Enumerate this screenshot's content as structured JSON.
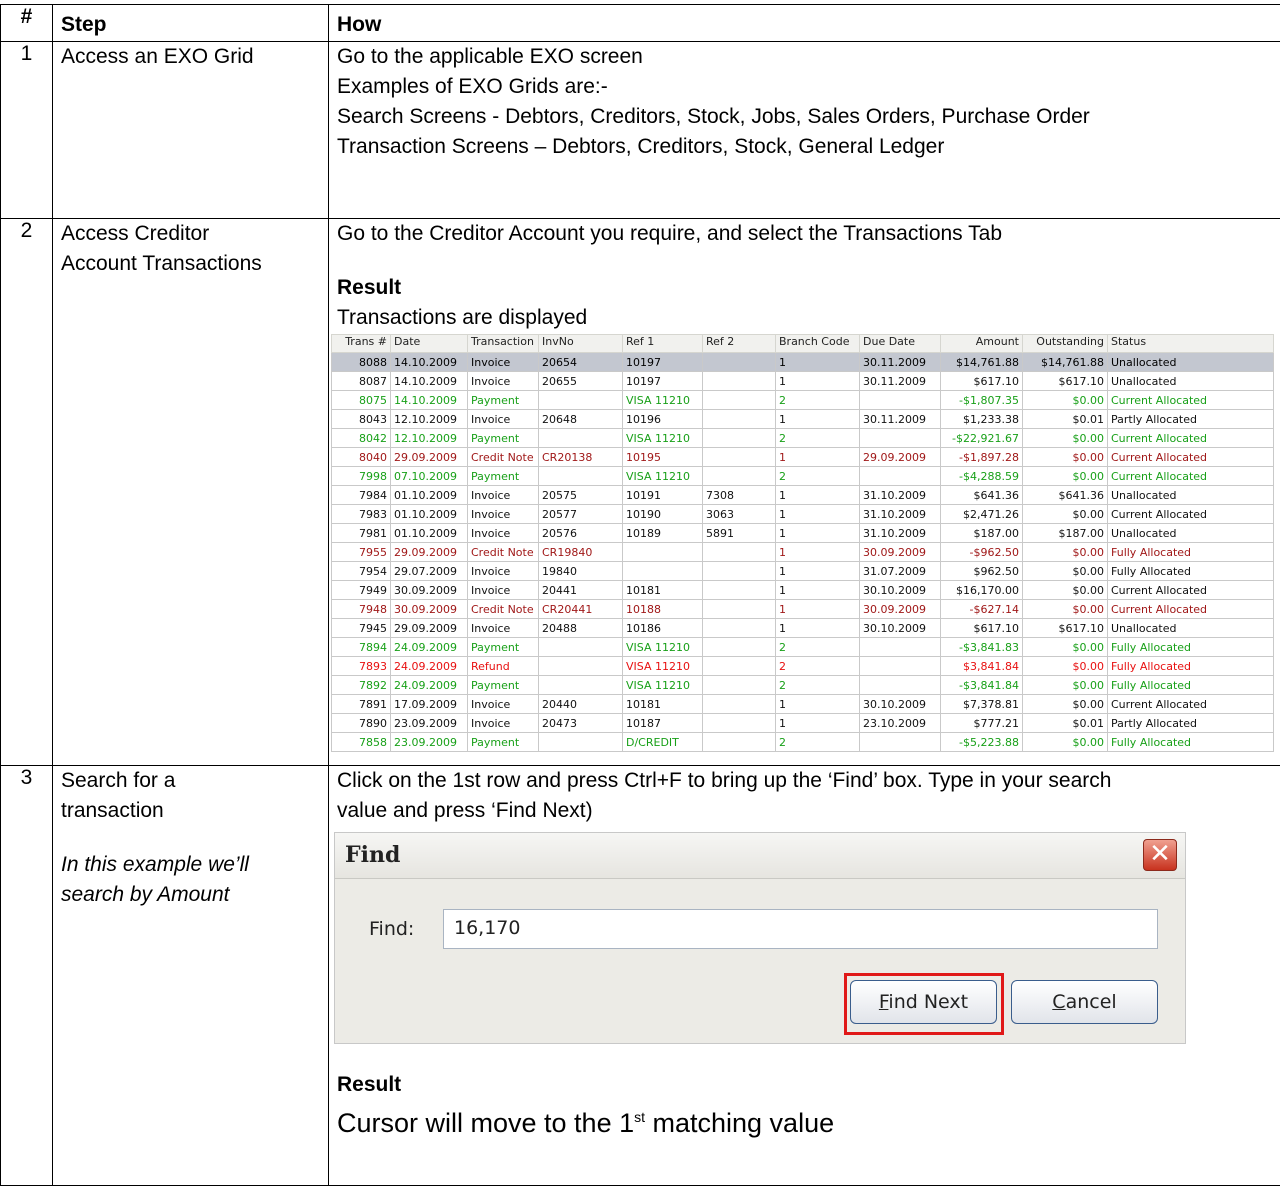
{
  "header": {
    "num": "#",
    "step": "Step",
    "how": "How"
  },
  "row1": {
    "num": "1",
    "step": "Access an EXO Grid",
    "how": [
      "Go to the applicable EXO screen",
      "Examples of EXO Grids are:-",
      "Search Screens - Debtors, Creditors, Stock, Jobs, Sales Orders, Purchase Order",
      "Transaction Screens – Debtors, Creditors, Stock, General Ledger"
    ]
  },
  "row2": {
    "num": "2",
    "step_line1": "Access Creditor",
    "step_line2": "Account Transactions",
    "how_line": "Go to the Creditor Account you require, and select the Transactions Tab",
    "result_label": "Result",
    "result_text": "Transactions are displayed"
  },
  "grid": {
    "columns": [
      "Trans #",
      "Date",
      "Transaction",
      "InvNo",
      "Ref 1",
      "Ref 2",
      "Branch Code",
      "Due Date",
      "Amount",
      "Outstanding",
      "Status"
    ],
    "rows": [
      {
        "style": "sel",
        "cells": [
          "8088",
          "14.10.2009",
          "Invoice",
          "20654",
          "10197",
          "",
          "1",
          "30.11.2009",
          "$14,761.88",
          "$14,761.88",
          "Unallocated"
        ]
      },
      {
        "style": "black",
        "cells": [
          "8087",
          "14.10.2009",
          "Invoice",
          "20655",
          "10197",
          "",
          "1",
          "30.11.2009",
          "$617.10",
          "$617.10",
          "Unallocated"
        ]
      },
      {
        "style": "green",
        "cells": [
          "8075",
          "14.10.2009",
          "Payment",
          "",
          "VISA 11210",
          "",
          "2",
          "",
          "-$1,807.35",
          "$0.00",
          "Current Allocated"
        ]
      },
      {
        "style": "black",
        "cells": [
          "8043",
          "12.10.2009",
          "Invoice",
          "20648",
          "10196",
          "",
          "1",
          "30.11.2009",
          "$1,233.38",
          "$0.01",
          "Partly Allocated"
        ]
      },
      {
        "style": "green",
        "cells": [
          "8042",
          "12.10.2009",
          "Payment",
          "",
          "VISA 11210",
          "",
          "2",
          "",
          "-$22,921.67",
          "$0.00",
          "Current Allocated"
        ]
      },
      {
        "style": "darkred",
        "cells": [
          "8040",
          "29.09.2009",
          "Credit Note",
          "CR20138",
          "10195",
          "",
          "1",
          "29.09.2009",
          "-$1,897.28",
          "$0.00",
          "Current Allocated"
        ]
      },
      {
        "style": "green",
        "cells": [
          "7998",
          "07.10.2009",
          "Payment",
          "",
          "VISA 11210",
          "",
          "2",
          "",
          "-$4,288.59",
          "$0.00",
          "Current Allocated"
        ]
      },
      {
        "style": "black",
        "cells": [
          "7984",
          "01.10.2009",
          "Invoice",
          "20575",
          "10191",
          "7308",
          "1",
          "31.10.2009",
          "$641.36",
          "$641.36",
          "Unallocated"
        ]
      },
      {
        "style": "black",
        "cells": [
          "7983",
          "01.10.2009",
          "Invoice",
          "20577",
          "10190",
          "3063",
          "1",
          "31.10.2009",
          "$2,471.26",
          "$0.00",
          "Current Allocated"
        ]
      },
      {
        "style": "black",
        "cells": [
          "7981",
          "01.10.2009",
          "Invoice",
          "20576",
          "10189",
          "5891",
          "1",
          "31.10.2009",
          "$187.00",
          "$187.00",
          "Unallocated"
        ]
      },
      {
        "style": "darkred",
        "cells": [
          "7955",
          "29.09.2009",
          "Credit Note",
          "CR19840",
          "",
          "",
          "1",
          "30.09.2009",
          "-$962.50",
          "$0.00",
          "Fully Allocated"
        ]
      },
      {
        "style": "black",
        "cells": [
          "7954",
          "29.07.2009",
          "Invoice",
          "19840",
          "",
          "",
          "1",
          "31.07.2009",
          "$962.50",
          "$0.00",
          "Fully Allocated"
        ]
      },
      {
        "style": "black",
        "cells": [
          "7949",
          "30.09.2009",
          "Invoice",
          "20441",
          "10181",
          "",
          "1",
          "30.10.2009",
          "$16,170.00",
          "$0.00",
          "Current Allocated"
        ]
      },
      {
        "style": "darkred",
        "cells": [
          "7948",
          "30.09.2009",
          "Credit Note",
          "CR20441",
          "10188",
          "",
          "1",
          "30.09.2009",
          "-$627.14",
          "$0.00",
          "Current Allocated"
        ]
      },
      {
        "style": "black",
        "cells": [
          "7945",
          "29.09.2009",
          "Invoice",
          "20488",
          "10186",
          "",
          "1",
          "30.10.2009",
          "$617.10",
          "$617.10",
          "Unallocated"
        ]
      },
      {
        "style": "green",
        "cells": [
          "7894",
          "24.09.2009",
          "Payment",
          "",
          "VISA 11210",
          "",
          "2",
          "",
          "-$3,841.83",
          "$0.00",
          "Fully Allocated"
        ]
      },
      {
        "style": "red",
        "cells": [
          "7893",
          "24.09.2009",
          "Refund",
          "",
          "VISA 11210",
          "",
          "2",
          "",
          "$3,841.84",
          "$0.00",
          "Fully Allocated"
        ]
      },
      {
        "style": "green",
        "cells": [
          "7892",
          "24.09.2009",
          "Payment",
          "",
          "VISA 11210",
          "",
          "2",
          "",
          "-$3,841.84",
          "$0.00",
          "Fully Allocated"
        ]
      },
      {
        "style": "black",
        "cells": [
          "7891",
          "17.09.2009",
          "Invoice",
          "20440",
          "10181",
          "",
          "1",
          "30.10.2009",
          "$7,378.81",
          "$0.00",
          "Current Allocated"
        ]
      },
      {
        "style": "black",
        "cells": [
          "7890",
          "23.09.2009",
          "Invoice",
          "20473",
          "10187",
          "",
          "1",
          "23.10.2009",
          "$777.21",
          "$0.01",
          "Partly Allocated"
        ]
      },
      {
        "style": "green",
        "cells": [
          "7858",
          "23.09.2009",
          "Payment",
          "",
          "D/CREDIT",
          "",
          "2",
          "",
          "-$5,223.88",
          "$0.00",
          "Fully Allocated"
        ]
      }
    ]
  },
  "row3": {
    "num": "3",
    "step_line1": "Search for a",
    "step_line2": "transaction",
    "step_note_line1": "In this example we’ll",
    "step_note_line2": "search by Amount",
    "how_line1": "Click on the 1st row and press Ctrl+F to bring up the ‘Find’ box.  Type in your search",
    "how_line2": "value and press ‘Find Next)",
    "result_label": "Result",
    "result_pre": "Cursor will move to the 1",
    "result_sup": "st",
    "result_post": " matching value"
  },
  "dialog": {
    "title": "Find",
    "close_glyph": "✕",
    "label": "Find:",
    "value": "16,170",
    "find_next": "Find Next",
    "cancel": "Cancel"
  }
}
